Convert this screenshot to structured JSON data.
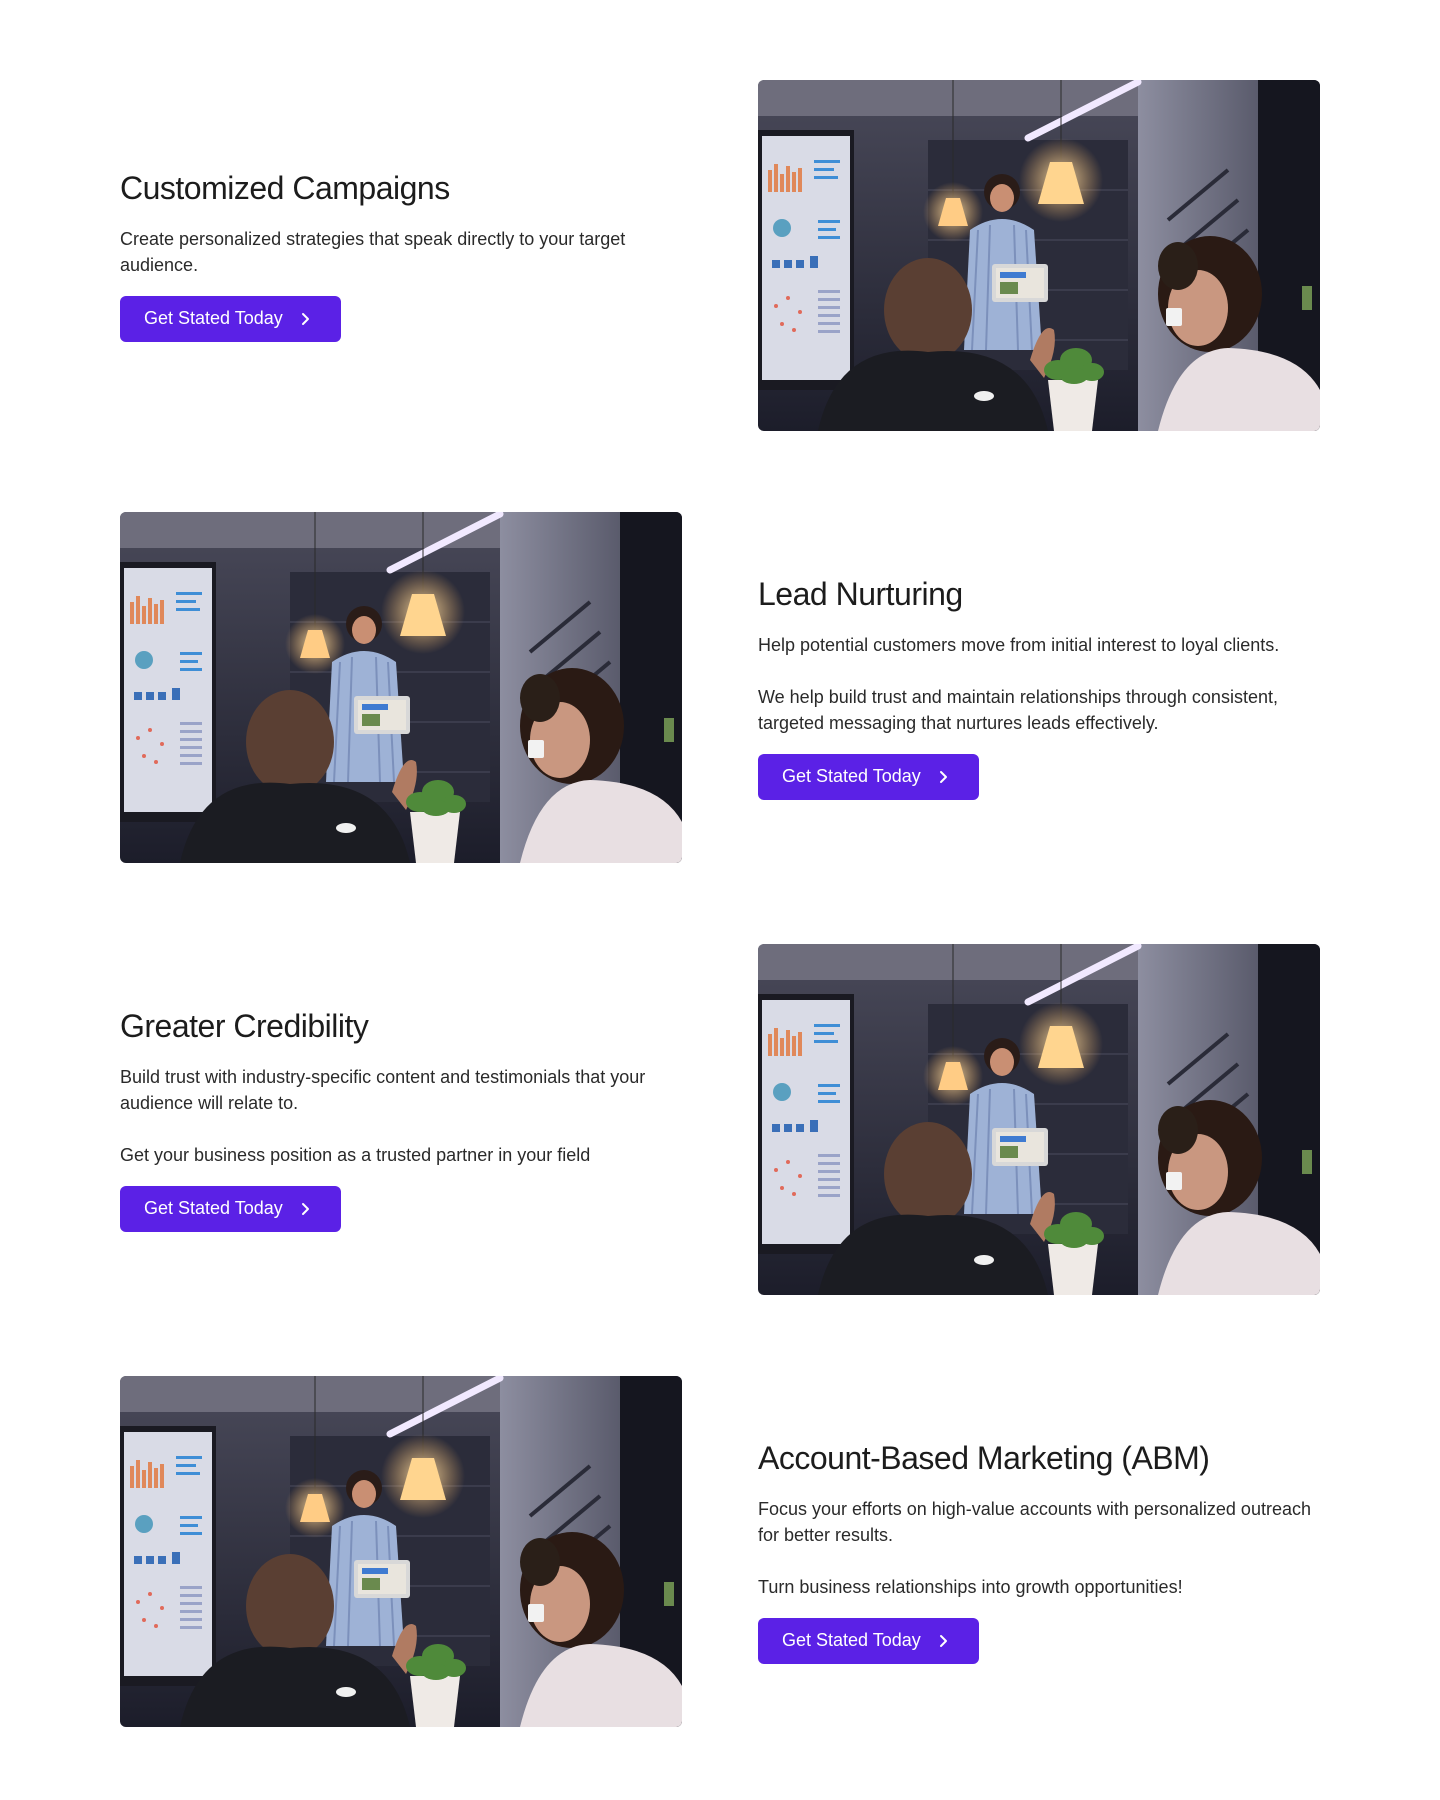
{
  "sections": [
    {
      "title": "Customized Campaigns",
      "paragraphs": [
        "Create personalized strategies that speak directly to your target audience."
      ],
      "button": "Get Stated Today",
      "image": "team-meeting-photo"
    },
    {
      "title": "Lead Nurturing",
      "paragraphs": [
        "Help potential customers move from initial interest to loyal clients.",
        "We help build trust and maintain relationships through consistent, targeted messaging that nurtures leads effectively."
      ],
      "button": "Get Stated Today",
      "image": "team-meeting-photo"
    },
    {
      "title": "Greater Credibility",
      "paragraphs": [
        "Build trust with industry-specific content and testimonials that your audience will relate to.",
        "Get your business position as a trusted partner in your field"
      ],
      "button": "Get Stated Today",
      "image": "team-meeting-photo"
    },
    {
      "title": "Account-Based Marketing (ABM)",
      "paragraphs": [
        "Focus your efforts on high-value accounts with personalized outreach for better results.",
        "Turn business relationships into growth opportunities!"
      ],
      "button": "Get Stated Today",
      "image": "team-meeting-photo"
    }
  ],
  "colors": {
    "accent": "#5b21e6",
    "text": "#1c1c1c",
    "background": "#ffffff"
  },
  "icons": {
    "button_icon": "chevron-right-icon"
  }
}
